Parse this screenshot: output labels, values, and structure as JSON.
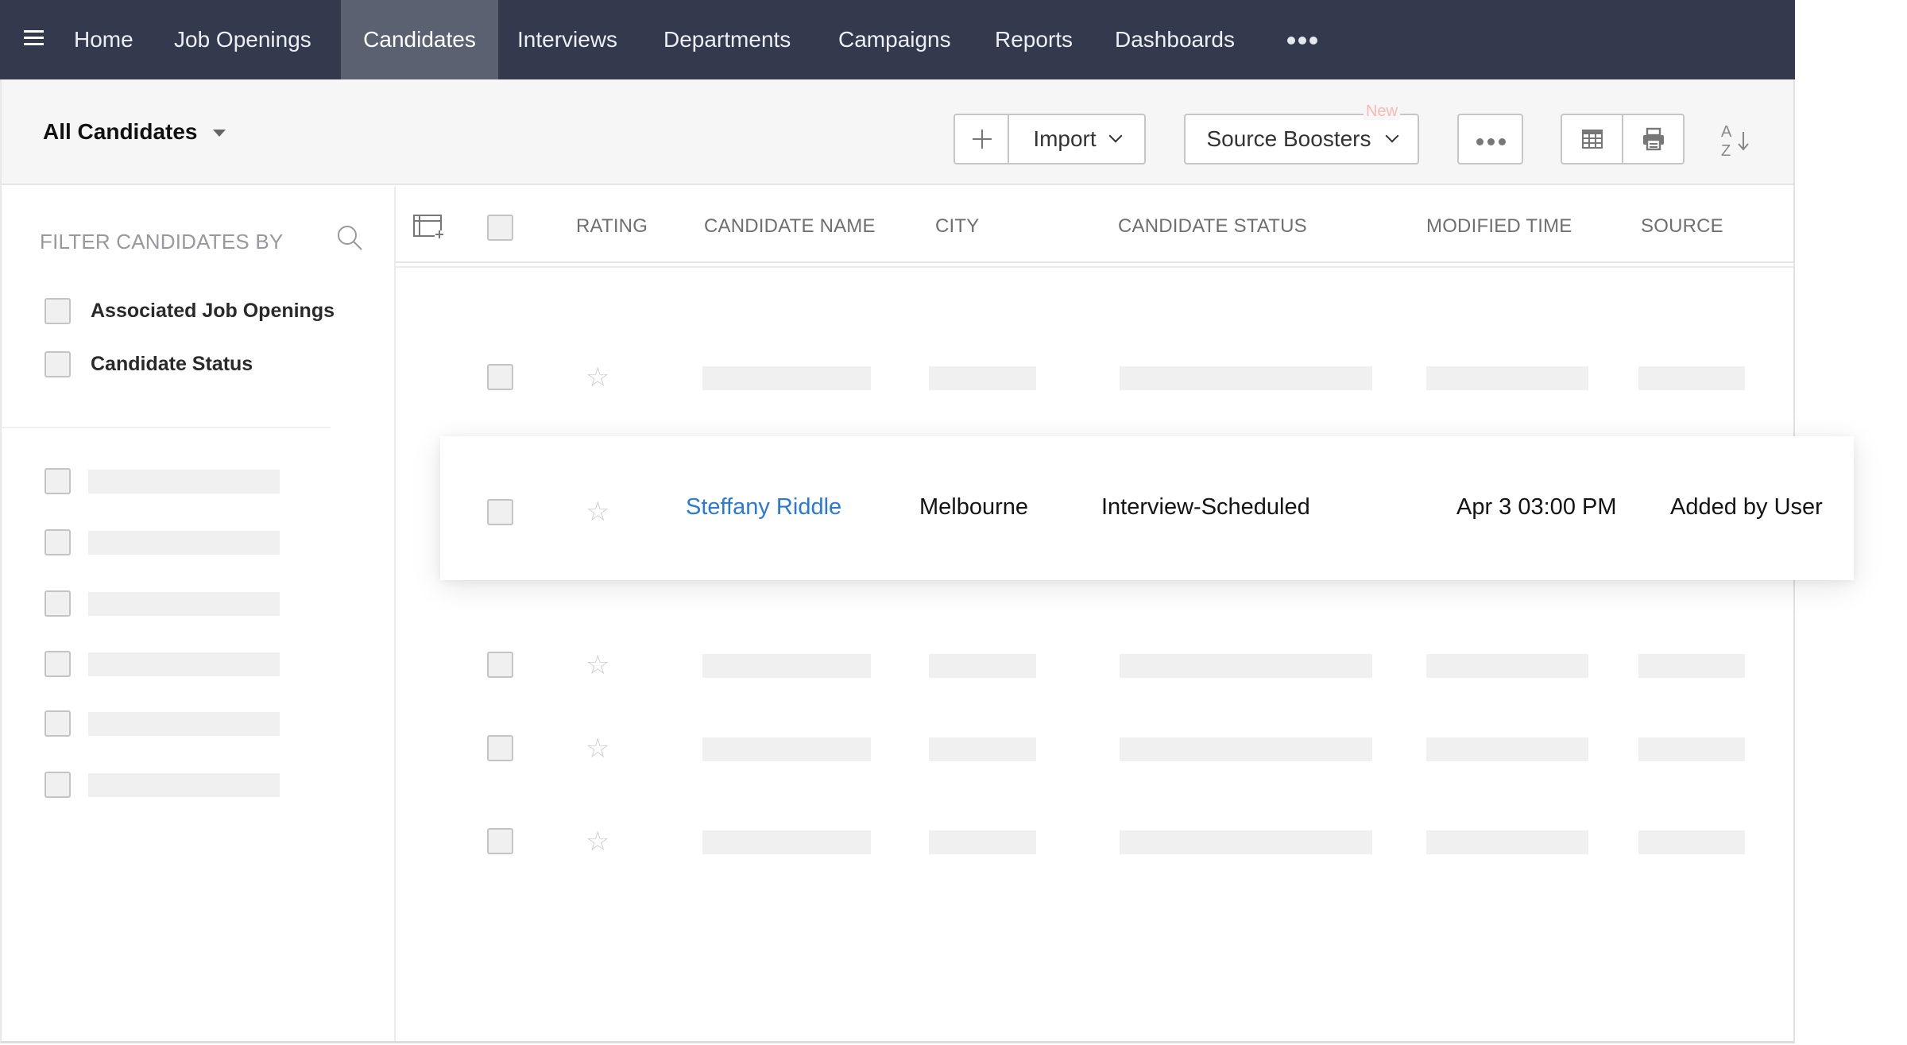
{
  "nav": {
    "menu_icon": "hamburger-icon",
    "items": [
      {
        "label": "Home",
        "active": false
      },
      {
        "label": "Job Openings",
        "active": false
      },
      {
        "label": "Candidates",
        "active": true
      },
      {
        "label": "Interviews",
        "active": false
      },
      {
        "label": "Departments",
        "active": false
      },
      {
        "label": "Campaigns",
        "active": false
      },
      {
        "label": "Reports",
        "active": false
      },
      {
        "label": "Dashboards",
        "active": false
      }
    ],
    "more_icon": "more-horizontal-icon"
  },
  "toolbar": {
    "view_label": "All Candidates",
    "add_icon": "plus-icon",
    "import_label": "Import",
    "source_boosters_label": "Source Boosters",
    "new_badge": "New",
    "more_icon": "more-horizontal-icon",
    "table_view_icon": "table-grid-icon",
    "print_icon": "printer-icon",
    "sort_icon": "sort-az-icon"
  },
  "sidebar": {
    "title": "FILTER CANDIDATES BY",
    "search_icon": "search-icon",
    "filters": [
      {
        "label": "Associated Job Openings",
        "checked": false
      },
      {
        "label": "Candidate Status",
        "checked": false
      }
    ],
    "placeholder_filter_count": 6
  },
  "table": {
    "columns": [
      "RATING",
      "CANDIDATE NAME",
      "CITY",
      "CANDIDATE STATUS",
      "MODIFIED TIME",
      "SOURCE"
    ],
    "column_settings_icon": "table-columns-add-icon",
    "highlighted_row": {
      "rating_icon": "star-outline-icon",
      "candidate_name": "Steffany Riddle",
      "city": "Melbourne",
      "candidate_status": "Interview-Scheduled",
      "modified_time": "Apr 3 03:00 PM",
      "source": "Added by User"
    },
    "placeholder_row_count": 4
  },
  "colors": {
    "nav_bg": "#343a4d",
    "nav_active_bg": "#5a6170",
    "link": "#2b79d2",
    "new_badge": "#f7b9b3"
  }
}
